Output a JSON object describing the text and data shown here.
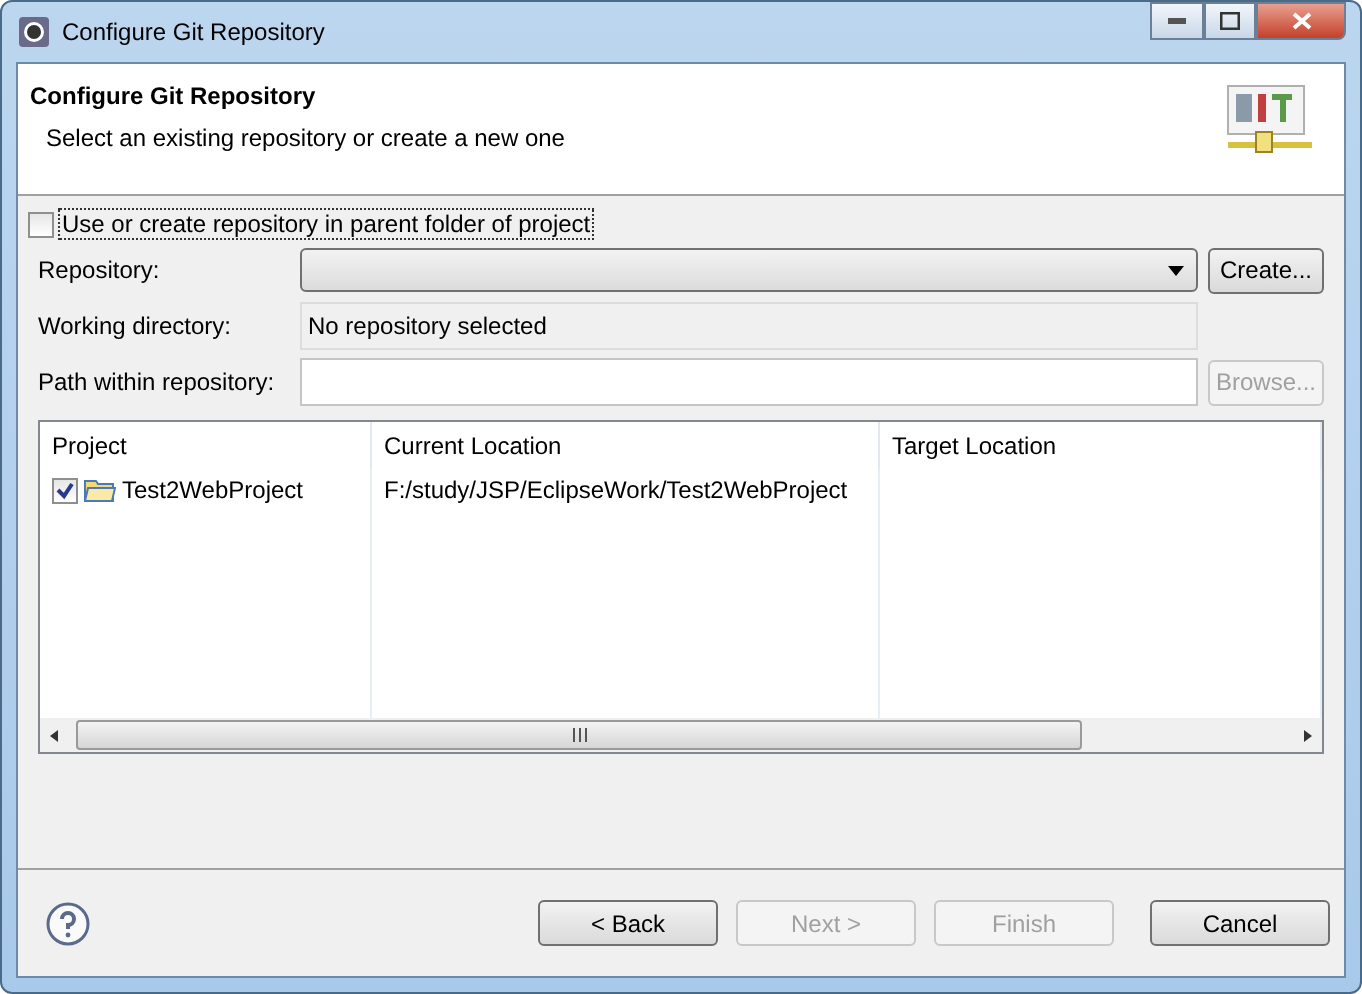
{
  "window": {
    "title": "Configure Git Repository"
  },
  "header": {
    "title": "Configure Git Repository",
    "subtitle": "Select an existing repository or create a new one"
  },
  "parent_folder_option": {
    "label": "Use or create repository in parent folder of project",
    "checked": false
  },
  "repository": {
    "label": "Repository:",
    "button": "Create..."
  },
  "working_directory": {
    "label": "Working directory:",
    "value": "No repository selected"
  },
  "path_within_repository": {
    "label": "Path within repository:",
    "button": "Browse...",
    "button_disabled": true
  },
  "table": {
    "columns": [
      "Project",
      "Current Location",
      "Target Location"
    ],
    "rows": [
      {
        "checked": true,
        "project": "Test2WebProject",
        "current_location": "F:/study/JSP/EclipseWork/Test2WebProject",
        "target_location": ""
      }
    ]
  },
  "buttons": [
    {
      "label": "< Back",
      "disabled": false
    },
    {
      "label": "Next >",
      "disabled": true
    },
    {
      "label": "Finish",
      "disabled": true
    },
    {
      "label": "Cancel",
      "disabled": false
    }
  ]
}
